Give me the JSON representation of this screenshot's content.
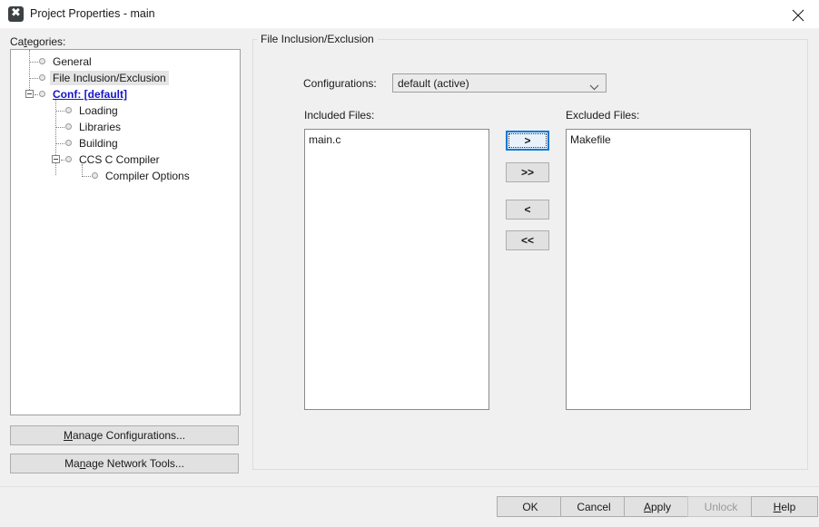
{
  "window": {
    "title": "Project Properties - main",
    "icon": "app-x-icon",
    "close_label": "close-icon"
  },
  "sidebar": {
    "label": "Categories:",
    "label_mnemonic": "e",
    "tree": [
      {
        "label": "General",
        "level": 0,
        "state": "normal",
        "expander": "none"
      },
      {
        "label": "File Inclusion/Exclusion",
        "level": 0,
        "state": "selected",
        "expander": "none"
      },
      {
        "label": "Conf: [default]",
        "level": 0,
        "state": "link",
        "expander": "collapse"
      },
      {
        "label": "Loading",
        "level": 1,
        "state": "normal",
        "expander": "none"
      },
      {
        "label": "Libraries",
        "level": 1,
        "state": "normal",
        "expander": "none"
      },
      {
        "label": "Building",
        "level": 1,
        "state": "normal",
        "expander": "none"
      },
      {
        "label": "CCS C Compiler",
        "level": 1,
        "state": "normal",
        "expander": "collapse"
      },
      {
        "label": "Compiler Options",
        "level": 2,
        "state": "normal",
        "expander": "none"
      }
    ],
    "buttons": [
      {
        "label": "Manage Configurations...",
        "mnemonic": "M"
      },
      {
        "label": "Manage Network Tools...",
        "mnemonic": "n"
      }
    ]
  },
  "main": {
    "group_title": "File Inclusion/Exclusion",
    "configurations": {
      "label": "Configurations:",
      "value": "default (active)",
      "options": [
        "default (active)"
      ]
    },
    "included": {
      "label": "Included Files:",
      "items": [
        "main.c"
      ]
    },
    "excluded": {
      "label": "Excluded Files:",
      "items": [
        "Makefile"
      ]
    },
    "transfer_buttons": [
      {
        "label": ">",
        "name": "move-right-button",
        "focused": true
      },
      {
        "label": ">>",
        "name": "move-all-right-button",
        "focused": false
      },
      {
        "label": "<",
        "name": "move-left-button",
        "focused": false
      },
      {
        "label": "<<",
        "name": "move-all-left-button",
        "focused": false
      }
    ]
  },
  "footer": {
    "buttons": [
      {
        "label": "OK",
        "enabled": true,
        "mnemonic": ""
      },
      {
        "label": "Cancel",
        "enabled": true,
        "mnemonic": ""
      },
      {
        "label": "Apply",
        "enabled": true,
        "mnemonic": "A"
      },
      {
        "label": "Unlock",
        "enabled": false,
        "mnemonic": ""
      },
      {
        "label": "Help",
        "enabled": true,
        "mnemonic": "H"
      }
    ]
  },
  "colors": {
    "body_bg": "#f0f0f0",
    "titlebar_bg": "#ffffff",
    "link": "#1515c8",
    "selection": "#e4e4e4",
    "focus_border": "#0078d7",
    "button_bg": "#e1e1e1",
    "disabled_text": "#9a9a9a"
  }
}
